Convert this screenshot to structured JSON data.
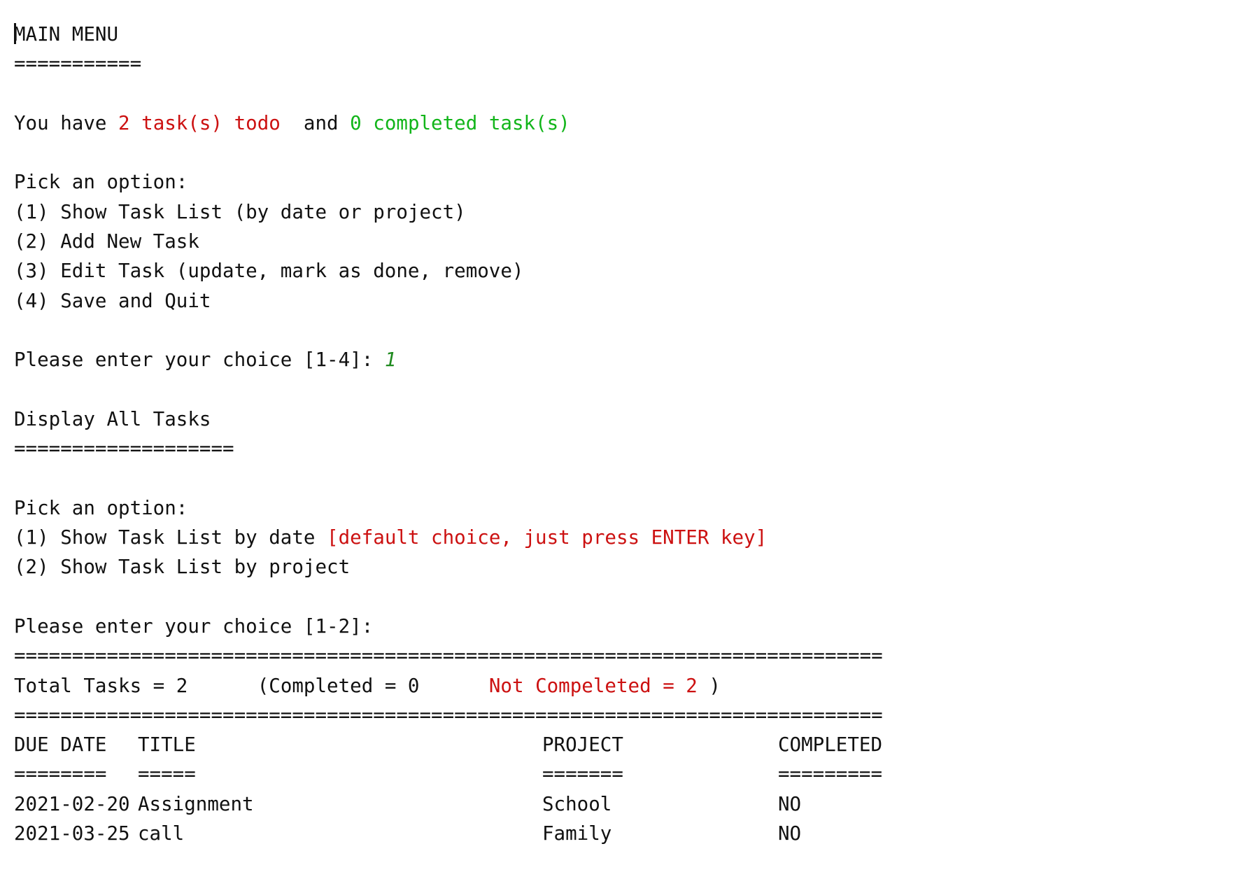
{
  "main_menu": {
    "title": "MAIN MENU",
    "underline": "===========",
    "status": {
      "prefix": "You have ",
      "todo_count": "2",
      "todo_label": " task(s) todo",
      "middle": "  and ",
      "completed_count": "0",
      "completed_label": " completed task(s)"
    },
    "prompt": "Pick an option:",
    "options": [
      "(1) Show Task List (by date or project)",
      "(2) Add New Task",
      "(3) Edit Task (update, mark as done, remove)",
      "(4) Save and Quit"
    ],
    "choice_prompt": "Please enter your choice [1-4]: ",
    "choice_input": "1"
  },
  "display_tasks": {
    "title": "Display All Tasks",
    "underline": "===================",
    "prompt": "Pick an option:",
    "option1": "(1) Show Task List by date ",
    "option1_hint": "[default choice, just press ENTER key]",
    "option2": "(2) Show Task List by project",
    "choice_prompt": "Please enter your choice [1-2]:"
  },
  "summary": {
    "separator": "===========================================================================",
    "total": "Total Tasks = 2",
    "completed": "(Completed = 0",
    "not_completed": "Not Compeleted = 2 ",
    "close": ")"
  },
  "table": {
    "headers": [
      "DUE DATE",
      "TITLE",
      "PROJECT",
      "COMPLETED"
    ],
    "underlines": [
      "========",
      "=====",
      "=======",
      "========="
    ],
    "rows": [
      [
        "2021-02-20",
        "Assignment",
        "School",
        "NO"
      ],
      [
        "2021-03-25",
        "call",
        "Family",
        "NO"
      ]
    ]
  }
}
